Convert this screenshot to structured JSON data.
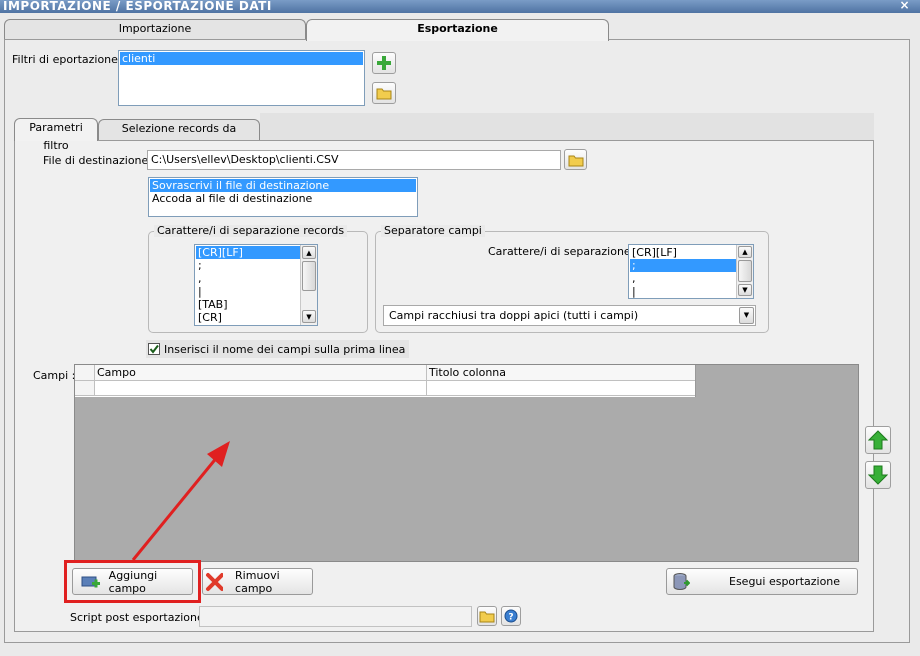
{
  "window": {
    "title": "IMPORTAZIONE / ESPORTAZIONE DATI",
    "close_symbol": "×"
  },
  "main_tabs": [
    {
      "label": "Importazione",
      "active": false
    },
    {
      "label": "Esportazione",
      "active": true
    }
  ],
  "filters": {
    "label": "Filtri di eportazione :",
    "items": [
      "clienti"
    ],
    "selected": "clienti"
  },
  "sub_tabs": [
    {
      "label": "Parametri filtro",
      "active": true
    },
    {
      "label": "Selezione records da esportare",
      "active": false
    }
  ],
  "destination": {
    "label": "File di destinazione :",
    "value": "C:\\Users\\ellev\\Desktop\\clienti.CSV"
  },
  "write_mode": {
    "options": [
      "Sovrascrivi il file di destinazione",
      "Accoda al file di destinazione"
    ],
    "selected": "Sovrascrivi il file di destinazione"
  },
  "record_separator": {
    "legend": "Carattere/i di separazione records",
    "options": [
      "[CR][LF]",
      ";",
      ",",
      "|",
      "[TAB]",
      "[CR]"
    ],
    "selected": "[CR][LF]"
  },
  "field_separator": {
    "legend": "Separatore campi",
    "label": "Carattere/i di separazione :",
    "options": [
      "[CR][LF]",
      ";",
      ",",
      "|"
    ],
    "selected": ";",
    "quote_mode": "Campi racchiusi tra doppi apici (tutti i campi)"
  },
  "header_checkbox": {
    "label": "Inserisci il nome dei campi sulla prima linea",
    "checked": true
  },
  "fields": {
    "label": "Campi :",
    "columns": [
      "Campo",
      "Titolo colonna"
    ],
    "rows": [
      [
        "",
        ""
      ]
    ]
  },
  "actions": {
    "add": "Aggiungi campo",
    "remove": "Rimuovi campo",
    "run": "Esegui esportazione"
  },
  "script": {
    "label": "Script post esportazione :",
    "value": ""
  },
  "colors": {
    "highlight": "#3399ff",
    "annotation": "#e02020",
    "grid_background": "#ababab"
  }
}
